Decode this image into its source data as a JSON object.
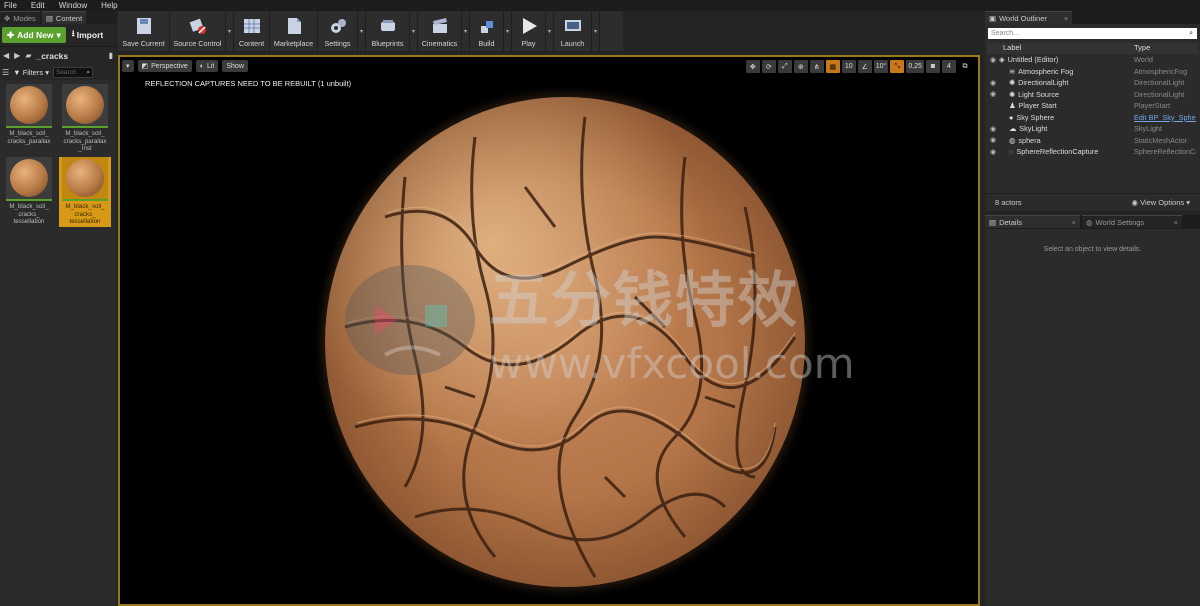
{
  "menu": [
    "File",
    "Edit",
    "Window",
    "Help"
  ],
  "left_tabs": [
    "Modes",
    "Content"
  ],
  "add_new_label": "Add New",
  "import_label": "Import",
  "path_folder": "_cracks",
  "filters_label": "Filters",
  "search_placeholder": "Search",
  "assets": [
    {
      "label": "M_black_soil_\ncracks_parallax"
    },
    {
      "label": "M_black_soil_\ncracks_parallax\n_Inst"
    },
    {
      "label": "M_black_soil_\ncracks_\ntessellation"
    },
    {
      "label": "M_black_soil_\ncracks_\ntessellation"
    }
  ],
  "toolbar": {
    "save_current": "Save Current",
    "source_control": "Source Control",
    "content": "Content",
    "marketplace": "Marketplace",
    "settings": "Settings",
    "blueprints": "Blueprints",
    "cinematics": "Cinematics",
    "build": "Build",
    "play": "Play",
    "launch": "Launch"
  },
  "viewport": {
    "perspective": "Perspective",
    "lit": "Lit",
    "show": "Show",
    "grid_value": "10",
    "angle_value": "10°",
    "scale_value": "0,25",
    "camera_speed": "4",
    "message": "REFLECTION CAPTURES NEED TO BE REBUILT (1 unbuilt)"
  },
  "watermark": {
    "cn": "五分钱特效",
    "url": "www.vfxcool.com"
  },
  "outliner": {
    "tab": "World Outliner",
    "search_placeholder": "Search...",
    "col_label": "Label",
    "col_type": "Type",
    "rows": [
      {
        "label": "Untitled (Editor)",
        "type": "World"
      },
      {
        "label": "Atmospheric Fog",
        "type": "AtmosphericFog"
      },
      {
        "label": "DirectionalLight",
        "type": "DirectionalLight"
      },
      {
        "label": "Light Source",
        "type": "DirectionalLight"
      },
      {
        "label": "Player Start",
        "type": "PlayerStart"
      },
      {
        "label": "Sky Sphere",
        "type": "Edit BP_Sky_Sphere"
      },
      {
        "label": "SkyLight",
        "type": "SkyLight"
      },
      {
        "label": "sphera",
        "type": "StaticMeshActor"
      },
      {
        "label": "SphereReflectionCapture",
        "type": "SphereReflectionCapture"
      }
    ],
    "actor_count": "8 actors",
    "view_options": "View Options"
  },
  "details": {
    "tab_details": "Details",
    "tab_world": "World Settings",
    "empty_message": "Select an object to view details."
  },
  "colors": {
    "accent_green": "#5aa02c",
    "selection_orange": "#d89a16",
    "link_blue": "#6ea6e6"
  }
}
